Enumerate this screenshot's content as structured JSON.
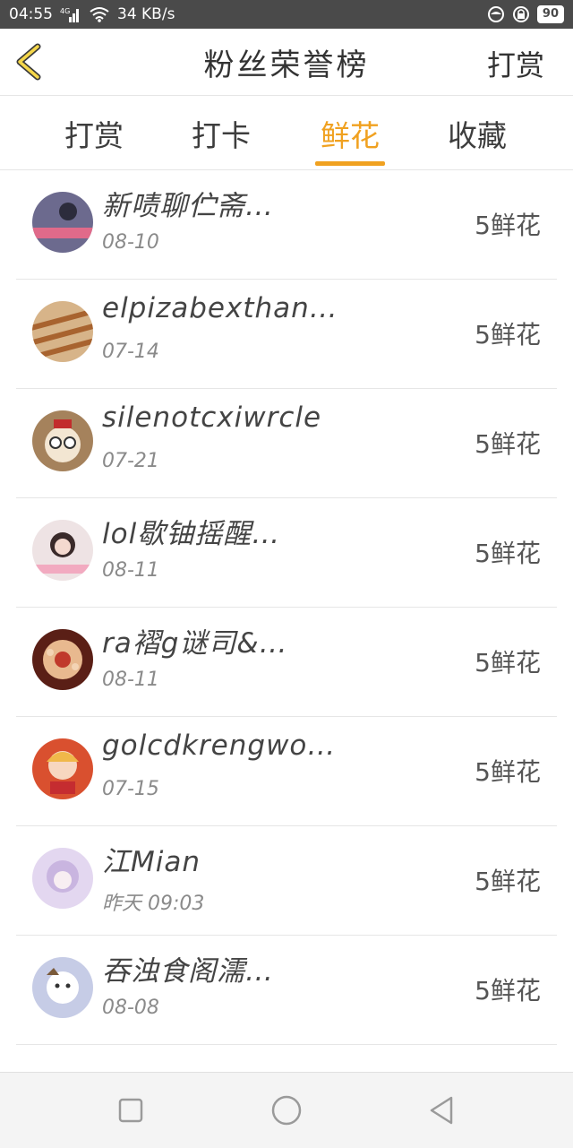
{
  "status_bar": {
    "time": "04:55",
    "network": "4G",
    "speed": "34 KB/s",
    "battery": "90"
  },
  "header": {
    "title": "粉丝荣誉榜",
    "action": "打赏",
    "back_icon": "chevron-left-icon",
    "accent_color": "#f0a120"
  },
  "tabs": [
    {
      "label": "打赏",
      "active": false
    },
    {
      "label": "打卡",
      "active": false
    },
    {
      "label": "鲜花",
      "active": true
    },
    {
      "label": "收藏",
      "active": false
    }
  ],
  "rows": [
    {
      "name": "新啧聊伫斋…",
      "date": "08-10",
      "amount": "5鲜花",
      "avatar_color": "#6c6a8e"
    },
    {
      "name": "elpizabexthan…",
      "date": "07-14",
      "amount": "5鲜花",
      "avatar_color": "#c89b60"
    },
    {
      "name": "silenotcxiwrcle",
      "date": "07-21",
      "amount": "5鲜花",
      "avatar_color": "#a5825c"
    },
    {
      "name": "lol歇铀摇醒…",
      "date": "08-11",
      "amount": "5鲜花",
      "avatar_color": "#e7d4d6"
    },
    {
      "name": "ra褶g谜司&…",
      "date": "08-11",
      "amount": "5鲜花",
      "avatar_color": "#a8452c"
    },
    {
      "name": "golcdkrengwo…",
      "date": "07-15",
      "amount": "5鲜花",
      "avatar_color": "#d9502f"
    },
    {
      "name": "江Mian",
      "date": "昨天 09:03",
      "amount": "5鲜花",
      "avatar_color": "#c9b5e0"
    },
    {
      "name": "吞浊食阁濡…",
      "date": "08-08",
      "amount": "5鲜花",
      "avatar_color": "#c6cce6"
    }
  ]
}
